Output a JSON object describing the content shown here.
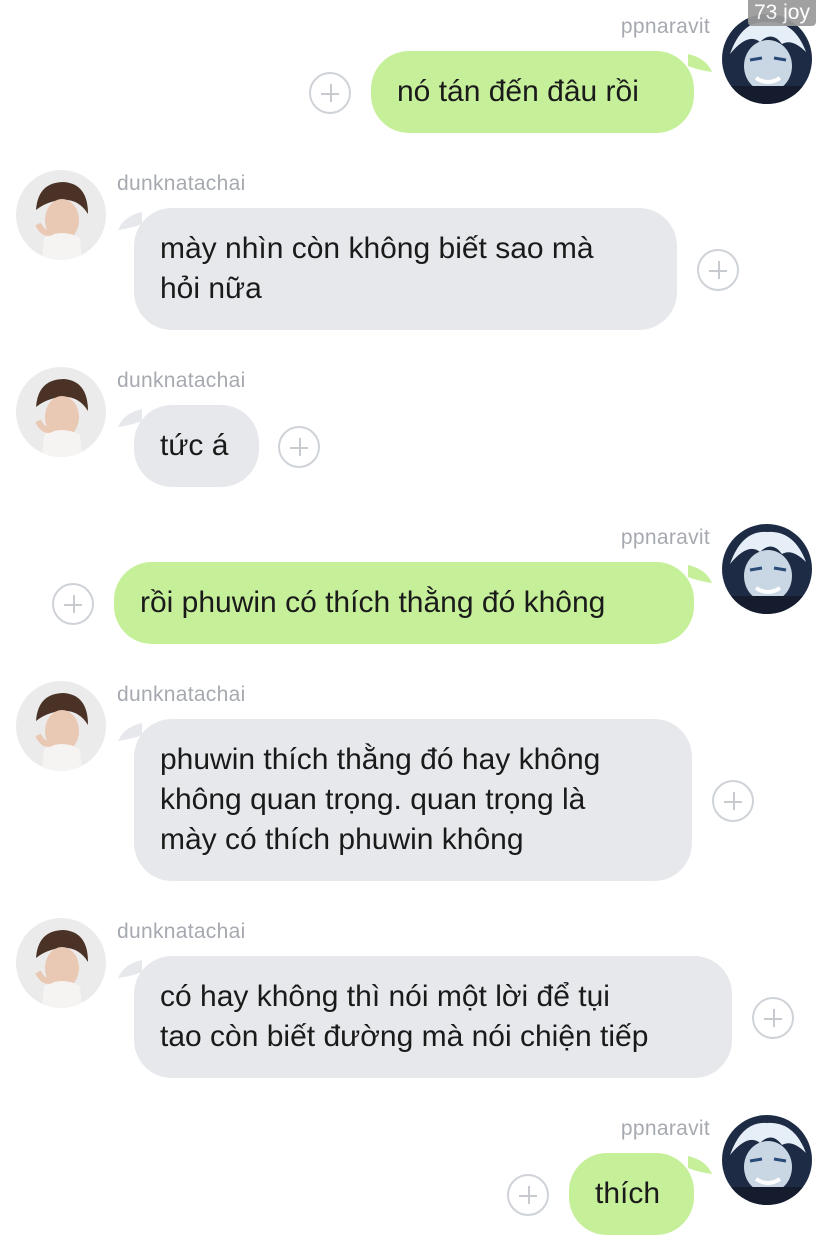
{
  "watermark": "73 joy",
  "colors": {
    "incoming_bubble": "#e6e8ec",
    "outgoing_bubble": "#c6ef9a",
    "name_text": "#a6aab0"
  },
  "messages": [
    {
      "sender": "ppnaravit",
      "direction": "outgoing",
      "lines": [
        "nó tán đến đâu rồi"
      ]
    },
    {
      "sender": "dunknatachai",
      "direction": "incoming",
      "lines": [
        "mày nhìn còn không biết sao mà",
        "hỏi nữa"
      ]
    },
    {
      "sender": "dunknatachai",
      "direction": "incoming",
      "lines": [
        "tức á"
      ]
    },
    {
      "sender": "ppnaravit",
      "direction": "outgoing",
      "lines": [
        "rồi phuwin có thích thằng đó không"
      ]
    },
    {
      "sender": "dunknatachai",
      "direction": "incoming",
      "lines": [
        "phuwin thích thằng đó hay không",
        "không quan trọng. quan trọng là",
        "mày có thích phuwin không"
      ]
    },
    {
      "sender": "dunknatachai",
      "direction": "incoming",
      "lines": [
        "có hay không thì nói một lời để tụi",
        "tao còn biết đường mà nói chiện tiếp"
      ]
    },
    {
      "sender": "ppnaravit",
      "direction": "outgoing",
      "lines": [
        "thích"
      ]
    }
  ]
}
